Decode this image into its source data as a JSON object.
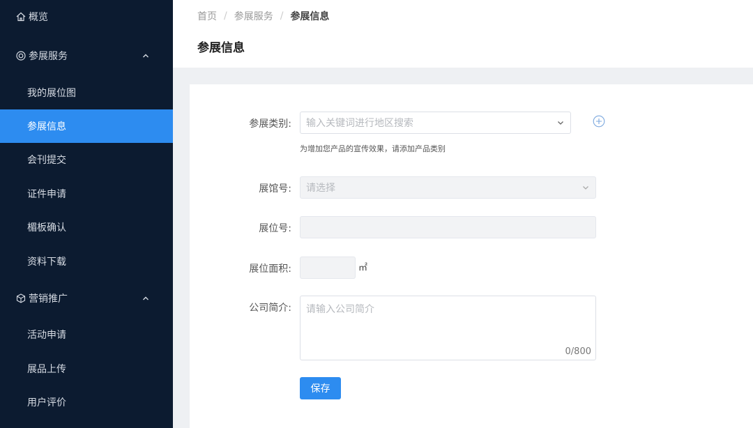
{
  "sidebar": {
    "overview": "概览",
    "group1": {
      "label": "参展服务",
      "items": [
        "我的展位图",
        "参展信息",
        "会刊提交",
        "证件申请",
        "楣板确认",
        "资料下载"
      ]
    },
    "group2": {
      "label": "营销推广",
      "items": [
        "活动申请",
        "展品上传",
        "用户评价"
      ]
    }
  },
  "header": {
    "breadcrumb": [
      "首页",
      "参展服务",
      "参展信息"
    ],
    "separator": "/",
    "title": "参展信息"
  },
  "form": {
    "category": {
      "label": "参展类别:",
      "placeholder": "输入关键词进行地区搜索",
      "hint": "为增加您产品的宣传效果，请添加产品类别"
    },
    "hall": {
      "label": "展馆号:",
      "placeholder": "请选择"
    },
    "booth": {
      "label": "展位号:",
      "value": ""
    },
    "area": {
      "label": "展位面积:",
      "value": "",
      "unit": "㎡"
    },
    "intro": {
      "label": "公司简介:",
      "placeholder": "请输入公司简介",
      "count": "0/800"
    },
    "save_label": "保存"
  },
  "colors": {
    "sidebar_bg": "#0c1b30",
    "accent": "#2d8cf0"
  }
}
